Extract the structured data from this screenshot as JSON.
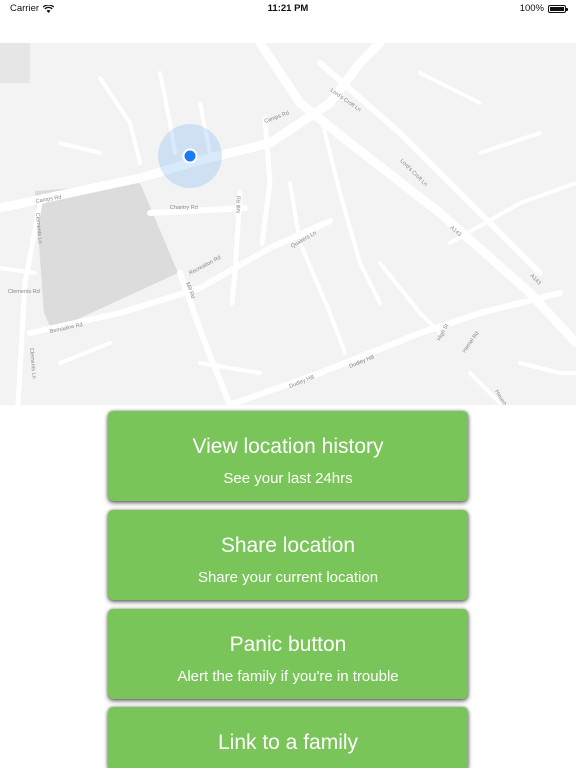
{
  "status_bar": {
    "carrier": "Carrier",
    "time": "11:21 PM",
    "battery": "100%"
  },
  "map": {
    "labels": [
      "Lord's Croft Ln",
      "Lord's Croft Ln",
      "Camps Rd",
      "Chantry Rd",
      "Mill Rd",
      "Dudley Hill",
      "Dudley Hill",
      "High St",
      "Hamel Rd",
      "Clements Ln",
      "Clements Ln",
      "Clements Rd",
      "Bernadine Rd",
      "Recreation Rd",
      "Mill Rd",
      "A143",
      "A143",
      "Haverhill",
      "Camps Rd",
      "Quakers Ln"
    ],
    "location_color": "#1a7cf5"
  },
  "actions": [
    {
      "title": "View location history",
      "subtitle": "See your last 24hrs"
    },
    {
      "title": "Share location",
      "subtitle": "Share your current location"
    },
    {
      "title": "Panic button",
      "subtitle": "Alert the family if you're in trouble"
    },
    {
      "title": "Link to a family",
      "subtitle": ""
    }
  ],
  "colors": {
    "button_green": "#7ac55a",
    "map_background": "#f3f3f3"
  }
}
